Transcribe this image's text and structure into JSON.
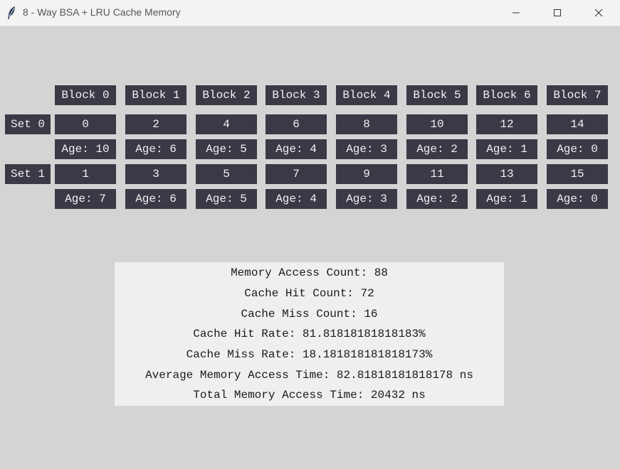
{
  "window": {
    "title": "8 - Way BSA + LRU Cache Memory",
    "icon": "feather-icon"
  },
  "blocks": [
    "Block 0",
    "Block 1",
    "Block 2",
    "Block 3",
    "Block 4",
    "Block 5",
    "Block 6",
    "Block 7"
  ],
  "sets": [
    {
      "label": "Set 0",
      "values": [
        "0",
        "2",
        "4",
        "6",
        "8",
        "10",
        "12",
        "14"
      ],
      "ages": [
        "Age: 10",
        "Age: 6",
        "Age: 5",
        "Age: 4",
        "Age: 3",
        "Age: 2",
        "Age: 1",
        "Age: 0"
      ]
    },
    {
      "label": "Set 1",
      "values": [
        "1",
        "3",
        "5",
        "7",
        "9",
        "11",
        "13",
        "15"
      ],
      "ages": [
        "Age: 7",
        "Age: 6",
        "Age: 5",
        "Age: 4",
        "Age: 3",
        "Age: 2",
        "Age: 1",
        "Age: 0"
      ]
    }
  ],
  "stats": {
    "memory_access_count": "Memory Access Count: 88",
    "cache_hit_count": "Cache Hit Count: 72",
    "cache_miss_count": "Cache Miss Count: 16",
    "cache_hit_rate": "Cache Hit Rate: 81.81818181818183%",
    "cache_miss_rate": "Cache Miss Rate: 18.181818181818173%",
    "average_access_time": "Average Memory Access Time: 82.81818181818178 ns",
    "total_access_time": "Total Memory Access Time: 20432 ns"
  },
  "colors": {
    "cell_bg": "#3a3946",
    "cell_text": "#f2f2f2",
    "window_bg": "#d4d4d4",
    "stats_bg": "#efefef"
  }
}
